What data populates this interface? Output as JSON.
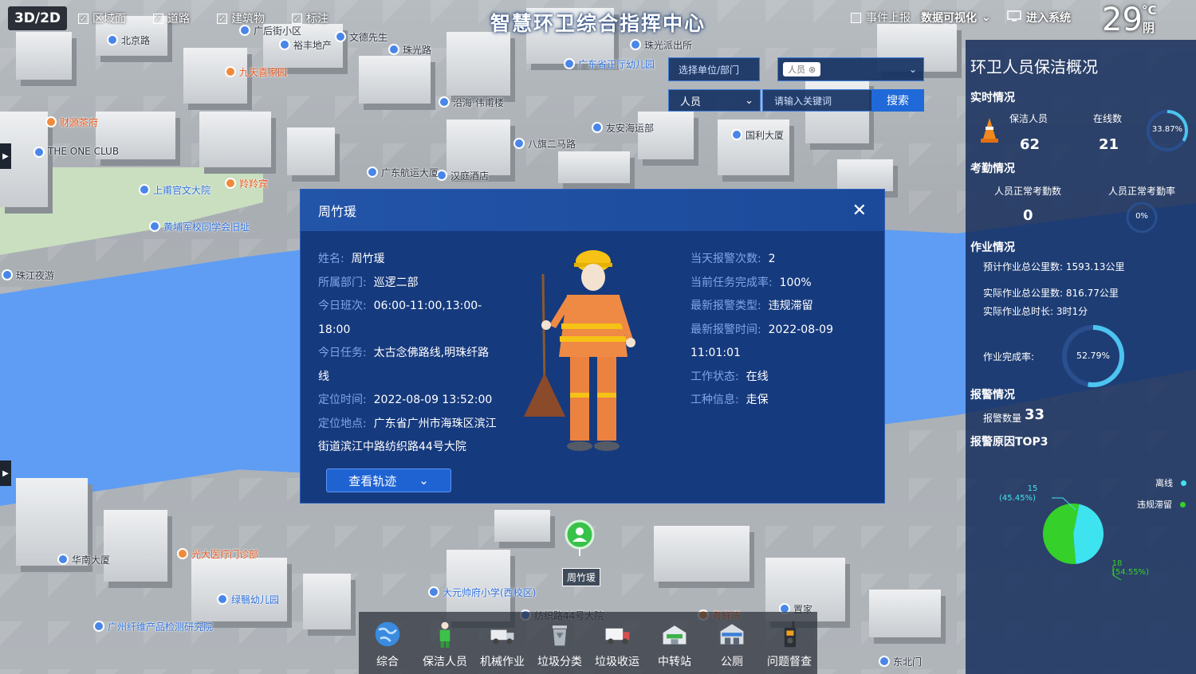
{
  "topbar": {
    "view_toggle": "3D/2D",
    "layers": [
      {
        "label": "区域面",
        "checked": true
      },
      {
        "label": "道路",
        "checked": true
      },
      {
        "label": "建筑物",
        "checked": true
      },
      {
        "label": "标注",
        "checked": true
      }
    ],
    "title": "智慧环卫综合指挥中心",
    "event_report": "事件上报",
    "data_viz": "数据可视化",
    "enter_system": "进入系统",
    "temperature": "29",
    "temp_unit": "°C",
    "weather": "阴"
  },
  "search": {
    "unit_placeholder": "选择单位/部门",
    "tag_label": "人员",
    "type_value": "人员",
    "keyword_placeholder": "请输入关键词",
    "search_label": "搜索"
  },
  "map_labels": [
    "北京路",
    "广后街小区",
    "裕丰地产",
    "文德先生",
    "珠光路",
    "沿海·伟甫楼",
    "九天喜家园",
    "财源茶府",
    "THE ONE CLUB",
    "上甫官文大院",
    "羚羚宾",
    "黄埔军校同学会旧址",
    "珠江夜游",
    "八旗二马路",
    "友安海运部",
    "国利大厦",
    "华南大厦",
    "光大医疗门诊部",
    "绿翳幼儿园",
    "广州纤维产品检测研究院",
    "大元帅府小学(西校区)",
    "纺织路44号大院",
    "粤鲜湾",
    "置家",
    "东北门",
    "汉庭酒店",
    "广东航运大厦",
    "珠光派出所",
    "广东省正厅幼儿园"
  ],
  "modal": {
    "title": "周竹瑗",
    "left": [
      {
        "label": "姓名:",
        "value": "周竹瑗"
      },
      {
        "label": "所属部门:",
        "value": "巡逻二部"
      },
      {
        "label": "今日班次:",
        "value": "06:00-11:00,13:00-18:00"
      },
      {
        "label": "今日任务:",
        "value": "太古念佛路线,明珠纤路线"
      },
      {
        "label": "定位时间:",
        "value": "2022-08-09 13:52:00"
      },
      {
        "label": "定位地点:",
        "value": "广东省广州市海珠区滨江街道滨江中路纺织路44号大院"
      }
    ],
    "right": [
      {
        "label": "当天报警次数:",
        "value": "2"
      },
      {
        "label": "当前任务完成率:",
        "value": "100%"
      },
      {
        "label": "最新报警类型:",
        "value": "违规滞留"
      },
      {
        "label": "最新报警时间:",
        "value": "2022-08-09 11:01:01"
      },
      {
        "label": "工作状态:",
        "value": "在线"
      },
      {
        "label": "工种信息:",
        "value": "走保"
      }
    ],
    "track_button": "查看轨迹"
  },
  "panel": {
    "title": "环卫人员保洁概况",
    "realtime": {
      "heading": "实时情况",
      "staff_label": "保洁人员",
      "staff_value": "62",
      "online_label": "在线数",
      "online_value": "21",
      "online_rate": "33.87%",
      "online_rate_fraction": 0.3387
    },
    "attendance": {
      "heading": "考勤情况",
      "normal_label": "人员正常考勤数",
      "normal_value": "0",
      "rate_label": "人员正常考勤率",
      "rate_value": "0%",
      "rate_fraction": 0
    },
    "work": {
      "heading": "作业情况",
      "planned": "预计作业总公里数: 1593.13公里",
      "actual": "实际作业总公里数: 816.77公里",
      "duration": "实际作业总时长: 3时1分",
      "completion_label": "作业完成率:",
      "completion_value": "52.79%",
      "completion_fraction": 0.5279
    },
    "alarm": {
      "heading": "报警情况",
      "count_label": "报警数量",
      "count_value": "33"
    },
    "top3": {
      "heading": "报警原因TOP3"
    }
  },
  "chart_data": {
    "type": "pie",
    "categories": [
      "离线",
      "违规滞留"
    ],
    "values": [
      15,
      18
    ],
    "labels": [
      "15",
      "18"
    ],
    "percents": [
      "(45.45%)",
      "(54.55%)"
    ],
    "colors": [
      "#3ee3f0",
      "#35d12a"
    ]
  },
  "colors": {
    "accent": "#1f63d3",
    "modal_bg": "#163a7e",
    "label_blue": "#7fa6e6",
    "pie_offline": "#3ee3f0",
    "pie_violation": "#35d12a"
  },
  "marker": {
    "label": "周竹瑗"
  },
  "dock": [
    {
      "label": "综合",
      "icon": "globe-icon"
    },
    {
      "label": "保洁人员",
      "icon": "cleaner-icon"
    },
    {
      "label": "机械作业",
      "icon": "truck-icon"
    },
    {
      "label": "垃圾分类",
      "icon": "trash-bin-icon"
    },
    {
      "label": "垃圾收运",
      "icon": "garbage-truck-icon"
    },
    {
      "label": "中转站",
      "icon": "transfer-station-icon"
    },
    {
      "label": "公厕",
      "icon": "toilet-icon"
    },
    {
      "label": "问题督查",
      "icon": "walkie-talkie-icon"
    }
  ]
}
